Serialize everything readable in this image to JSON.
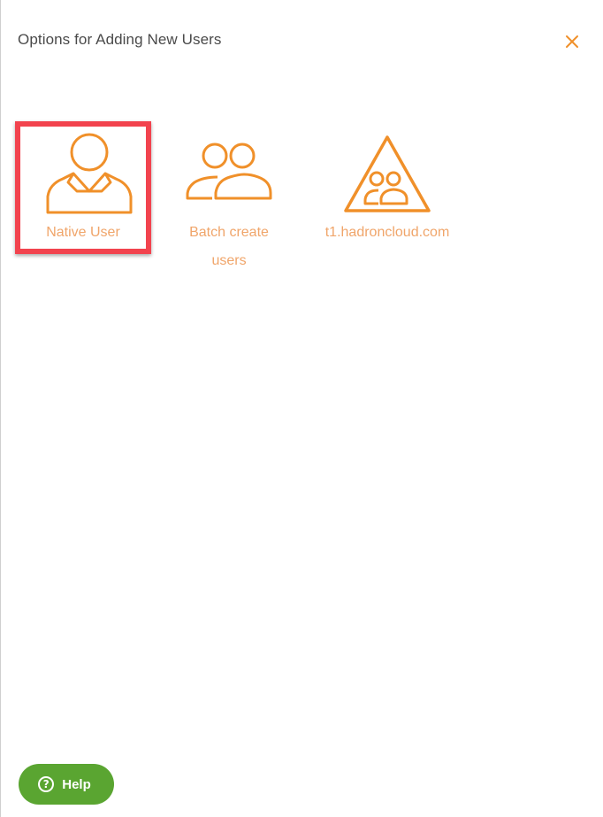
{
  "panel": {
    "title": "Options for Adding New Users",
    "close_icon": "close-icon"
  },
  "options": [
    {
      "label": "Native User",
      "icon": "single-user-icon",
      "highlighted": true
    },
    {
      "label": "Batch create users",
      "icon": "multiple-users-icon",
      "highlighted": false
    },
    {
      "label": "t1.hadroncloud.com",
      "icon": "domain-group-icon",
      "highlighted": false
    }
  ],
  "help": {
    "label": "Help",
    "icon_glyph": "?",
    "icon": "help-icon"
  },
  "colors": {
    "accent": "#f0902a",
    "label": "#f0a56a",
    "highlight": "#f2434e",
    "help_bg": "#5aa531"
  }
}
